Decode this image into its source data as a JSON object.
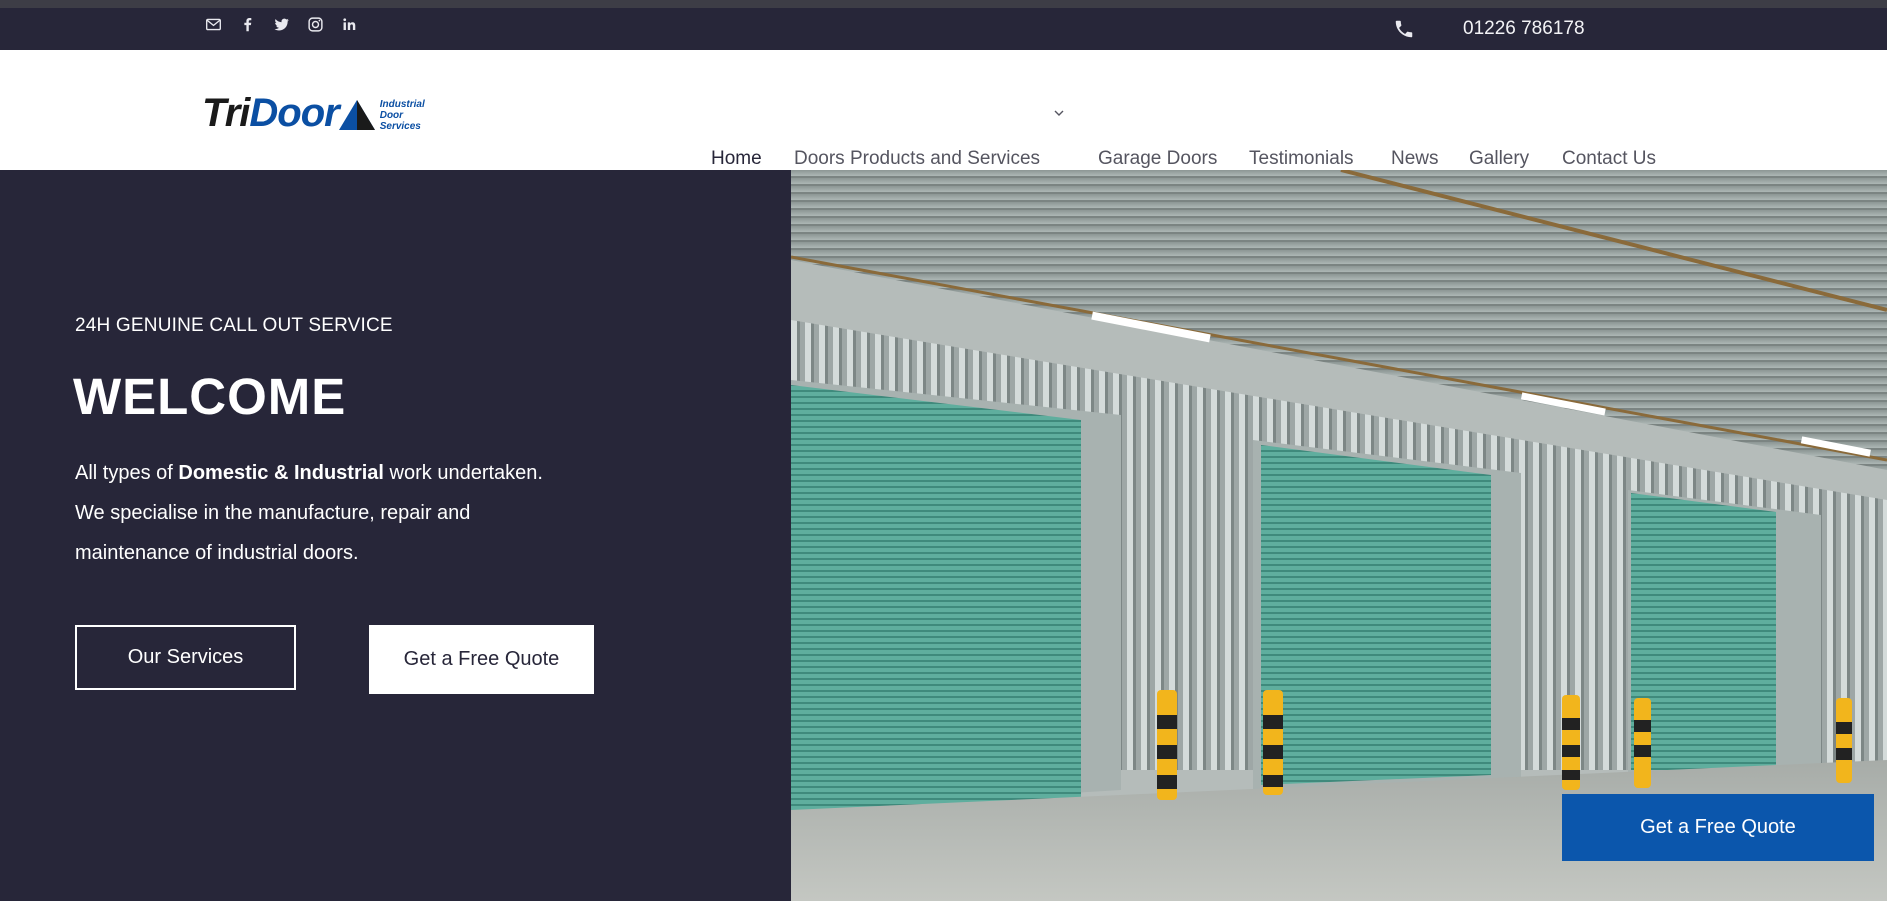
{
  "topbar": {
    "social_icons": [
      "mail-icon",
      "facebook-icon",
      "twitter-icon",
      "instagram-icon",
      "linkedin-icon"
    ],
    "phone_icon": "phone-icon",
    "phone_number": "01226 786178"
  },
  "header": {
    "logo": {
      "word_tri": "Tri",
      "word_door": "Door",
      "tagline_1": "Industrial",
      "tagline_2": "Door",
      "tagline_3": "Services"
    },
    "nav": [
      {
        "label": "Home",
        "active": true
      },
      {
        "label": "Doors Products and Services",
        "has_dropdown": true
      },
      {
        "label": "Garage Doors"
      },
      {
        "label": "Testimonials"
      },
      {
        "label": "News"
      },
      {
        "label": "Gallery"
      },
      {
        "label": "Contact Us"
      }
    ]
  },
  "hero": {
    "kicker": "24H GENUINE CALL OUT SERVICE",
    "title": "WELCOME",
    "blurb_pre": "All types of ",
    "blurb_bold": "Domestic & Industrial",
    "blurb_post": " work undertaken. We specialise in the manufacture, repair and maintenance of industrial doors.",
    "primary_button": "Our Services",
    "secondary_button": "Get a Free Quote"
  },
  "floating_cta": "Get a Free Quote",
  "colors": {
    "navy": "#272639",
    "brand_blue": "#0b56ac",
    "door_teal": "#5fae9e"
  }
}
